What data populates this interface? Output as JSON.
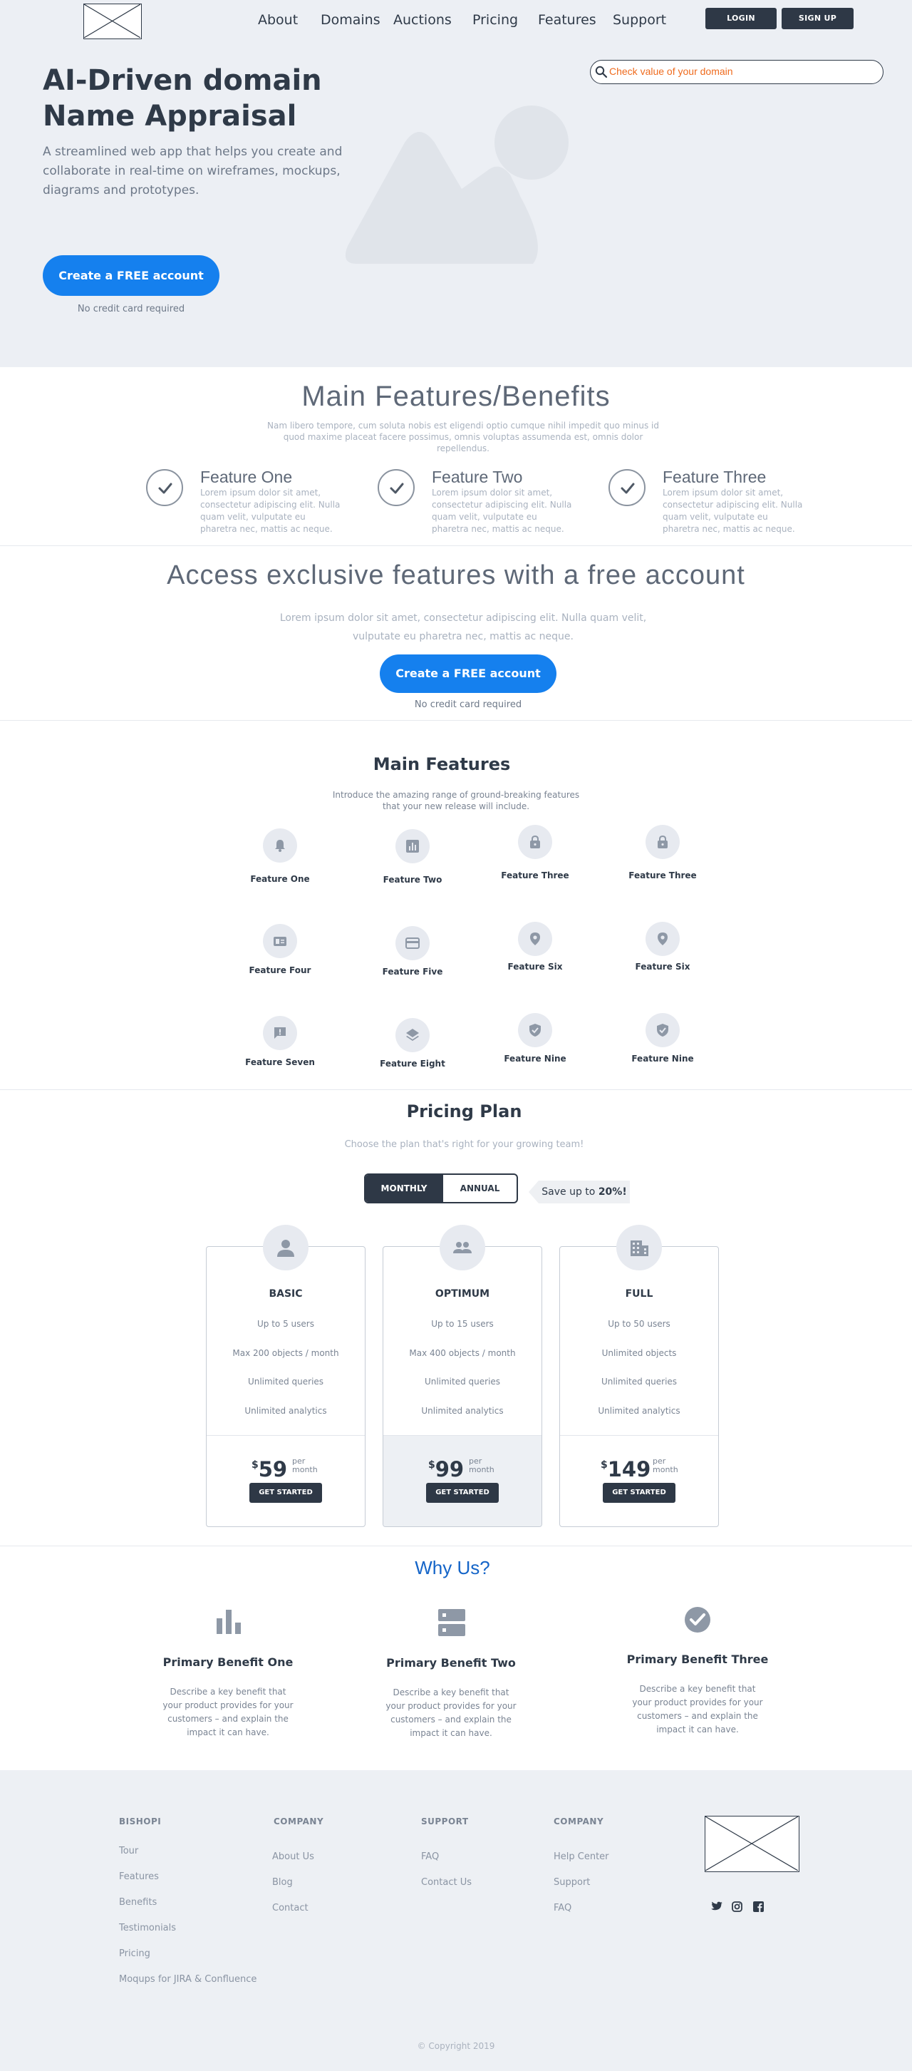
{
  "nav": {
    "links": [
      "About",
      "Domains",
      "Auctions",
      "Pricing",
      "Features",
      "Support"
    ],
    "login": "LOGIN",
    "signup": "SIGN UP"
  },
  "search": {
    "placeholder": "Check value of your domain"
  },
  "hero": {
    "title": "AI-Driven domain Name Appraisal",
    "subtitle": "A streamlined web app that helps you create and collaborate in real-time on wireframes, mockups, diagrams and prototypes.",
    "cta": "Create a FREE account",
    "note": "No credit card required"
  },
  "benefits": {
    "title": "Main Features/Benefits",
    "subtitle": "Nam libero tempore, cum soluta nobis est eligendi optio cumque nihil impedit quo minus id quod maxime placeat facere possimus, omnis voluptas assumenda est, omnis dolor repellendus.",
    "items": [
      {
        "title": "Feature One",
        "text": "Lorem ipsum dolor sit amet, consectetur adipiscing elit. Nulla quam velit, vulputate eu pharetra nec, mattis ac neque."
      },
      {
        "title": "Feature Two",
        "text": "Lorem ipsum dolor sit amet, consectetur adipiscing elit. Nulla quam velit, vulputate eu pharetra nec, mattis ac neque."
      },
      {
        "title": "Feature Three",
        "text": "Lorem ipsum dolor sit amet, consectetur adipiscing elit. Nulla quam velit, vulputate eu pharetra nec, mattis ac neque."
      }
    ]
  },
  "access": {
    "title": "Access exclusive features with a free account",
    "text": "Lorem ipsum dolor sit amet, consectetur adipiscing elit. Nulla quam velit, vulputate eu pharetra nec, mattis ac neque.",
    "cta": "Create a FREE account",
    "note": "No credit card required"
  },
  "main_features": {
    "title": "Main Features",
    "subtitle": "Introduce the amazing range of ground-breaking features that your new release will include.",
    "items": [
      {
        "label": "Feature One",
        "icon": "bell-icon"
      },
      {
        "label": "Feature Two",
        "icon": "bar-chart-icon"
      },
      {
        "label": "Feature Three",
        "icon": "lock-icon"
      },
      {
        "label": "Feature Three",
        "icon": "lock-icon"
      },
      {
        "label": "Feature Four",
        "icon": "id-card-icon"
      },
      {
        "label": "Feature Five",
        "icon": "credit-card-icon"
      },
      {
        "label": "Feature Six",
        "icon": "location-pin-icon"
      },
      {
        "label": "Feature Six",
        "icon": "location-pin-icon"
      },
      {
        "label": "Feature Seven",
        "icon": "feedback-icon"
      },
      {
        "label": "Feature Eight",
        "icon": "layers-icon"
      },
      {
        "label": "Feature Nine",
        "icon": "shield-check-icon"
      },
      {
        "label": "Feature Nine",
        "icon": "shield-check-icon"
      }
    ]
  },
  "pricing": {
    "title": "Pricing Plan",
    "subtitle": "Choose the plan that's right for your growing team!",
    "toggle": {
      "monthly": "MONTHLY",
      "annual": "ANNUAL",
      "active": "MONTHLY"
    },
    "save_prefix": "Save up to ",
    "save_value": "20%!",
    "plans": [
      {
        "name": "BASIC",
        "icon": "user-icon",
        "features": [
          "Up to 5 users",
          "Max 200 objects / month",
          "Unlimited queries",
          "Unlimited analytics"
        ],
        "currency": "$",
        "price": "59",
        "per": "per",
        "period": "month",
        "cta": "GET STARTED",
        "highlight": false
      },
      {
        "name": "OPTIMUM",
        "icon": "group-icon",
        "features": [
          "Up to 15 users",
          "Max 400 objects / month",
          "Unlimited queries",
          "Unlimited analytics"
        ],
        "currency": "$",
        "price": "99",
        "per": "per",
        "period": "month",
        "cta": "GET STARTED",
        "highlight": true
      },
      {
        "name": "FULL",
        "icon": "building-icon",
        "features": [
          "Up to 50 users",
          "Unlimited objects",
          "Unlimited queries",
          "Unlimited analytics"
        ],
        "currency": "$",
        "price": "149",
        "per": "per",
        "period": "month",
        "cta": "GET STARTED",
        "highlight": false
      }
    ]
  },
  "why": {
    "title": "Why Us?",
    "items": [
      {
        "title": "Primary Benefit One",
        "text": "Describe a key benefit that your product provides for your customers – and explain the impact it can have.",
        "icon": "bar-chart-icon"
      },
      {
        "title": "Primary Benefit Two",
        "text": "Describe a key benefit that your product provides for your customers – and explain the impact it can have.",
        "icon": "server-icon"
      },
      {
        "title": "Primary Benefit Three",
        "text": "Describe a key benefit that your product provides for your customers – and explain the impact it can have.",
        "icon": "check-circle-icon"
      }
    ]
  },
  "footer": {
    "columns": [
      {
        "heading": "BISHOPI",
        "links": [
          "Tour",
          "Features",
          "Benefits",
          "Testimonials",
          "Pricing",
          "Moqups for JIRA & Confluence"
        ]
      },
      {
        "heading": "COMPANY",
        "links": [
          "About Us",
          "Blog",
          "Contact"
        ]
      },
      {
        "heading": "SUPPORT",
        "links": [
          "FAQ",
          "Contact Us"
        ]
      },
      {
        "heading": "COMPANY",
        "links": [
          "Help Center",
          "Support",
          "FAQ"
        ]
      }
    ],
    "social": [
      "twitter-icon",
      "instagram-icon",
      "facebook-icon"
    ],
    "copyright": "© Copyright 2019"
  },
  "colors": {
    "primary_blue": "#1580ee",
    "dark": "#2e3846",
    "hero_bg": "#eceff4",
    "search_text": "#ef6b1e",
    "why_title": "#1565c8"
  }
}
